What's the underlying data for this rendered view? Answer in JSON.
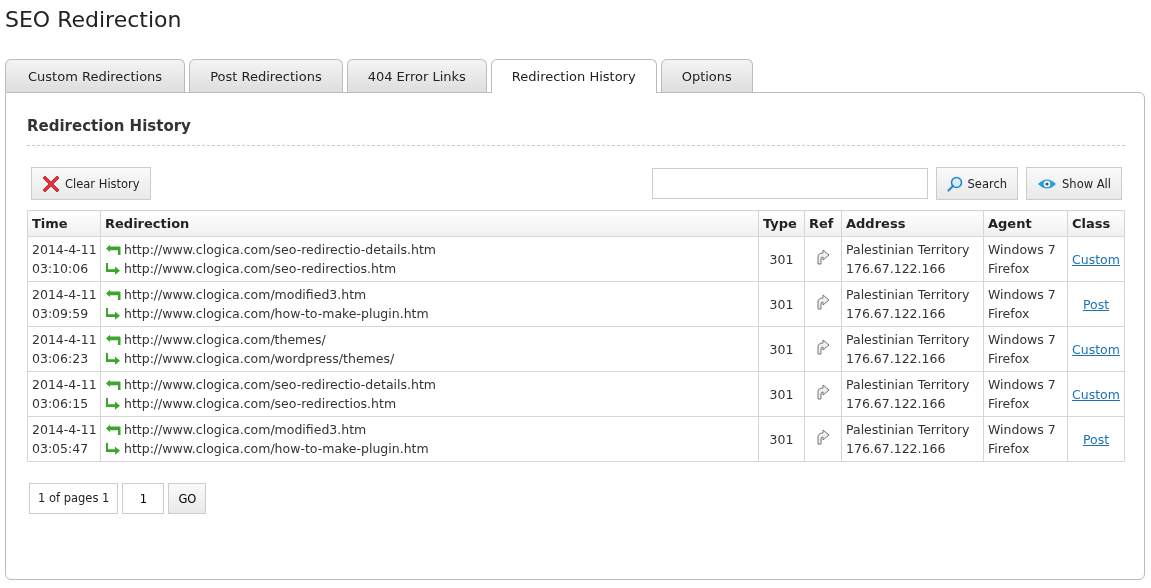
{
  "page_title": "SEO Redirection",
  "tabs": [
    {
      "label": "Custom Redirections",
      "selected": false
    },
    {
      "label": "Post Redirections",
      "selected": false
    },
    {
      "label": "404 Error Links",
      "selected": false
    },
    {
      "label": "Redirection History",
      "selected": true
    },
    {
      "label": "Options",
      "selected": false
    }
  ],
  "section_title": "Redirection History",
  "clear_button": "Clear History",
  "search": {
    "button": "Search"
  },
  "show_all_button": "Show All",
  "table": {
    "columns": [
      "Time",
      "Redirection",
      "Type",
      "Ref",
      "Address",
      "Agent",
      "Class"
    ],
    "rows": [
      {
        "date": "2014-4-11",
        "time": "03:10:06",
        "from": "http://www.clogica.com/seo-redirectio-details.htm",
        "to": "http://www.clogica.com/seo-redirectios.htm",
        "type": "301",
        "address": "Palestinian Territory",
        "ip": "176.67.122.166",
        "os": "Windows 7",
        "browser": "Firefox",
        "class": "Custom"
      },
      {
        "date": "2014-4-11",
        "time": "03:09:59",
        "from": "http://www.clogica.com/modified3.htm",
        "to": "http://www.clogica.com/how-to-make-plugin.htm",
        "type": "301",
        "address": "Palestinian Territory",
        "ip": "176.67.122.166",
        "os": "Windows 7",
        "browser": "Firefox",
        "class": "Post"
      },
      {
        "date": "2014-4-11",
        "time": "03:06:23",
        "from": "http://www.clogica.com/themes/",
        "to": "http://www.clogica.com/wordpress/themes/",
        "type": "301",
        "address": "Palestinian Territory",
        "ip": "176.67.122.166",
        "os": "Windows 7",
        "browser": "Firefox",
        "class": "Custom"
      },
      {
        "date": "2014-4-11",
        "time": "03:06:15",
        "from": "http://www.clogica.com/seo-redirectio-details.htm",
        "to": "http://www.clogica.com/seo-redirectios.htm",
        "type": "301",
        "address": "Palestinian Territory",
        "ip": "176.67.122.166",
        "os": "Windows 7",
        "browser": "Firefox",
        "class": "Custom"
      },
      {
        "date": "2014-4-11",
        "time": "03:05:47",
        "from": "http://www.clogica.com/modified3.htm",
        "to": "http://www.clogica.com/how-to-make-plugin.htm",
        "type": "301",
        "address": "Palestinian Territory",
        "ip": "176.67.122.166",
        "os": "Windows 7",
        "browser": "Firefox",
        "class": "Post"
      }
    ]
  },
  "pager": {
    "info": "1 of pages 1",
    "page": "1",
    "go": "GO"
  }
}
